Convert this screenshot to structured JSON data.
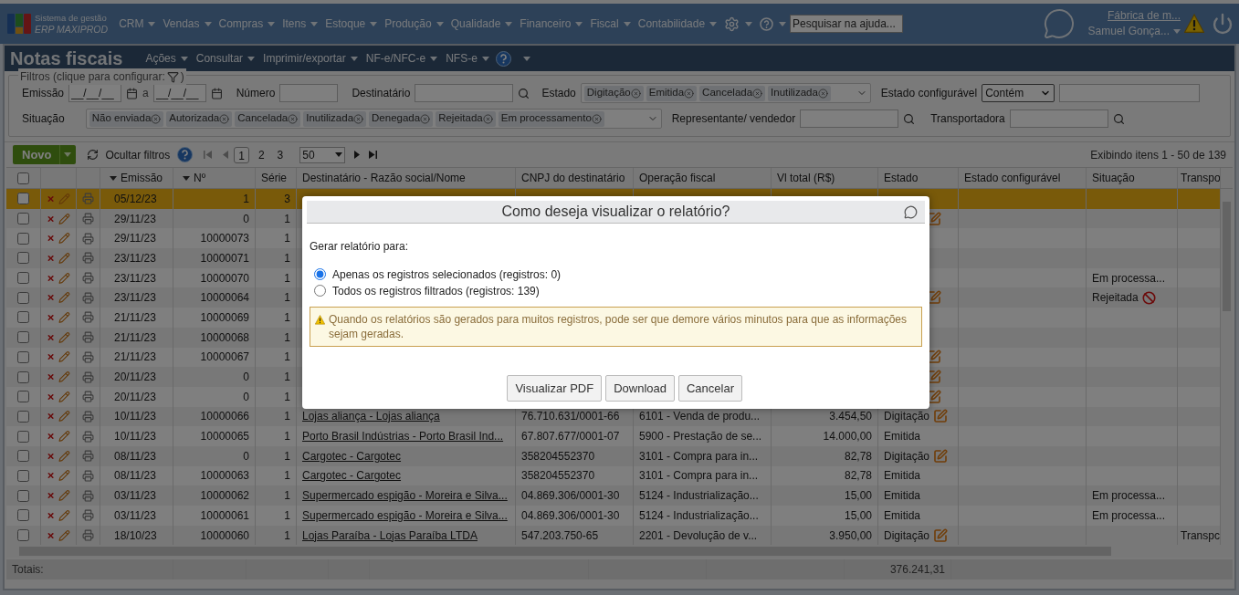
{
  "brand": {
    "line1": "Sistema de gestão",
    "line2": "ERP MAXIPROD"
  },
  "menu": [
    "CRM",
    "Vendas",
    "Compras",
    "Itens",
    "Estoque",
    "Produção",
    "Qualidade",
    "Financeiro",
    "Fiscal",
    "Contabilidade"
  ],
  "help_search": {
    "placeholder": "Pesquisar na ajuda..."
  },
  "user": {
    "company": "Fábrica de m...",
    "name": "Samuel Gonça..."
  },
  "page": {
    "title": "Notas fiscais",
    "menus": [
      "Ações",
      "Consultar",
      "Imprimir/exportar",
      "NF-e/NFC-e",
      "NFS-e"
    ]
  },
  "filters": {
    "legend_start": "Filtros (clique para configurar:",
    "legend_end": ")",
    "emissao": {
      "label": "Emissão",
      "from": "__/__/__",
      "sep": "a",
      "to": "__/__/__"
    },
    "numero": {
      "label": "Número"
    },
    "destinatario": {
      "label": "Destinatário"
    },
    "estado": {
      "label": "Estado",
      "tags": [
        "Digitação",
        "Emitida",
        "Cancelada",
        "Inutilizada"
      ]
    },
    "estado_configuravel": {
      "label": "Estado configurável",
      "mode": "Contém"
    },
    "situacao": {
      "label": "Situação",
      "tags": [
        "Não enviada",
        "Autorizada",
        "Cancelada",
        "Inutilizada",
        "Denegada",
        "Rejeitada",
        "Em processamento"
      ]
    },
    "representante": {
      "label": "Representante/ vendedor"
    },
    "transportadora": {
      "label": "Transportadora"
    }
  },
  "toolbar": {
    "new_button": "Novo",
    "hide_filters": "Ocultar filtros",
    "pages": [
      {
        "label": "1",
        "selected": true
      },
      {
        "label": "2",
        "selected": false
      },
      {
        "label": "3",
        "selected": false
      }
    ],
    "page_size": "50",
    "showing": "Exibindo itens 1 - 50 de 139"
  },
  "table": {
    "columns": [
      "Emissão",
      "Nº",
      "Série",
      "Destinatário - Razão social/Nome",
      "CNPJ do destinatário",
      "Operação fiscal",
      "Vl total (R$)",
      "Estado",
      "Estado configurável",
      "Situação",
      "Transpo"
    ],
    "select_all": {
      "checked": false
    },
    "rows": [
      {
        "emissao": "05/12/23",
        "numero": "1",
        "serie": "3",
        "selected": true,
        "checked": false,
        "edit_icon": false
      },
      {
        "emissao": "29/11/23",
        "numero": "0",
        "serie": "1",
        "selected": false,
        "checked": false,
        "edit_icon": true
      },
      {
        "emissao": "29/11/23",
        "numero": "10000073",
        "serie": "1",
        "selected": false,
        "checked": false,
        "edit_icon": false
      },
      {
        "emissao": "23/11/23",
        "numero": "10000071",
        "serie": "1",
        "selected": false,
        "checked": false,
        "edit_icon": false
      },
      {
        "emissao": "23/11/23",
        "numero": "10000070",
        "serie": "1",
        "selected": false,
        "checked": false,
        "edit_icon": false,
        "situacao": "Em processa..."
      },
      {
        "emissao": "23/11/23",
        "numero": "10000064",
        "serie": "1",
        "selected": false,
        "checked": false,
        "edit_icon": true,
        "situacao": "Rejeitada",
        "rejected": true
      },
      {
        "emissao": "21/11/23",
        "numero": "10000069",
        "serie": "1",
        "selected": false,
        "checked": false,
        "edit_icon": false
      },
      {
        "emissao": "21/11/23",
        "numero": "10000068",
        "serie": "1",
        "selected": false,
        "checked": false,
        "edit_icon": false
      },
      {
        "emissao": "21/11/23",
        "numero": "10000067",
        "serie": "1",
        "selected": false,
        "checked": false,
        "edit_icon": true
      },
      {
        "emissao": "20/11/23",
        "numero": "0",
        "serie": "1",
        "selected": false,
        "checked": false,
        "edit_icon": true
      },
      {
        "emissao": "20/11/23",
        "numero": "0",
        "serie": "1",
        "selected": false,
        "checked": false,
        "edit_icon": true
      },
      {
        "emissao": "10/11/23",
        "numero": "10000066",
        "serie": "1",
        "destinatario": "Lojas aliança - Lojas aliança",
        "cnpj": "76.710.631/0001-66",
        "operacao": "6101 - Venda de produ...",
        "total": "3.454,50",
        "estado": "Digitação",
        "selected": false,
        "checked": false,
        "edit_icon": true
      },
      {
        "emissao": "10/11/23",
        "numero": "10000065",
        "serie": "1",
        "destinatario": "Porto Brasil Indústrias - Porto Brasil Ind...",
        "cnpj": "67.807.677/0001-07",
        "operacao": "5900 - Prestação de se...",
        "total": "14.000,00",
        "estado": "Emitida",
        "selected": false,
        "checked": false,
        "edit_icon": false
      },
      {
        "emissao": "08/11/23",
        "numero": "0",
        "serie": "1",
        "destinatario": "Cargotec - Cargotec",
        "cnpj": "358204552370",
        "operacao": "3101 - Compra para in...",
        "total": "82,78",
        "estado": "Digitação",
        "selected": false,
        "checked": false,
        "edit_icon": true
      },
      {
        "emissao": "08/11/23",
        "numero": "10000063",
        "serie": "1",
        "destinatario": "Cargotec - Cargotec",
        "cnpj": "358204552370",
        "operacao": "3101 - Compra para in...",
        "total": "82,78",
        "estado": "Emitida",
        "selected": false,
        "checked": false,
        "edit_icon": false
      },
      {
        "emissao": "03/11/23",
        "numero": "10000062",
        "serie": "1",
        "destinatario": "Supermercado espigão - Moreira e Silva...",
        "cnpj": "04.869.306/0001-30",
        "operacao": "5124 - Industrialização...",
        "total": "15,00",
        "estado": "Emitida",
        "selected": false,
        "checked": false,
        "edit_icon": false,
        "situacao": "Em processa..."
      },
      {
        "emissao": "03/11/23",
        "numero": "10000061",
        "serie": "1",
        "destinatario": "Supermercado espigão - Moreira e Silva...",
        "cnpj": "04.869.306/0001-30",
        "operacao": "5124 - Industrialização...",
        "total": "15,00",
        "estado": "Emitida",
        "selected": false,
        "checked": false,
        "edit_icon": false,
        "situacao": "Em processa..."
      },
      {
        "emissao": "18/10/23",
        "numero": "10000060",
        "serie": "1",
        "destinatario": "Lojas Paraíba - Lojas Paraíba LTDA",
        "cnpj": "547.203.750-65",
        "operacao": "2201 - Devolução de v...",
        "total": "3.950,00",
        "estado": "Digitação",
        "selected": false,
        "checked": false,
        "edit_icon": true,
        "transportadora": "Transpc"
      }
    ],
    "totals_label": "Totais:",
    "totals_value": "376.241,31"
  },
  "dialog": {
    "title": "Como deseja visualizar o relatório?",
    "prompt": "Gerar relatório para:",
    "options": [
      {
        "label": "Apenas os registros selecionados (registros: 0)",
        "selected": true
      },
      {
        "label": "Todos os registros filtrados (registros: 139)",
        "selected": false
      }
    ],
    "warning": "Quando os relatórios são gerados para muitos registros, pode ser que demore vários minutos para que as informações sejam geradas.",
    "buttons": [
      "Visualizar PDF",
      "Download",
      "Cancelar"
    ]
  }
}
